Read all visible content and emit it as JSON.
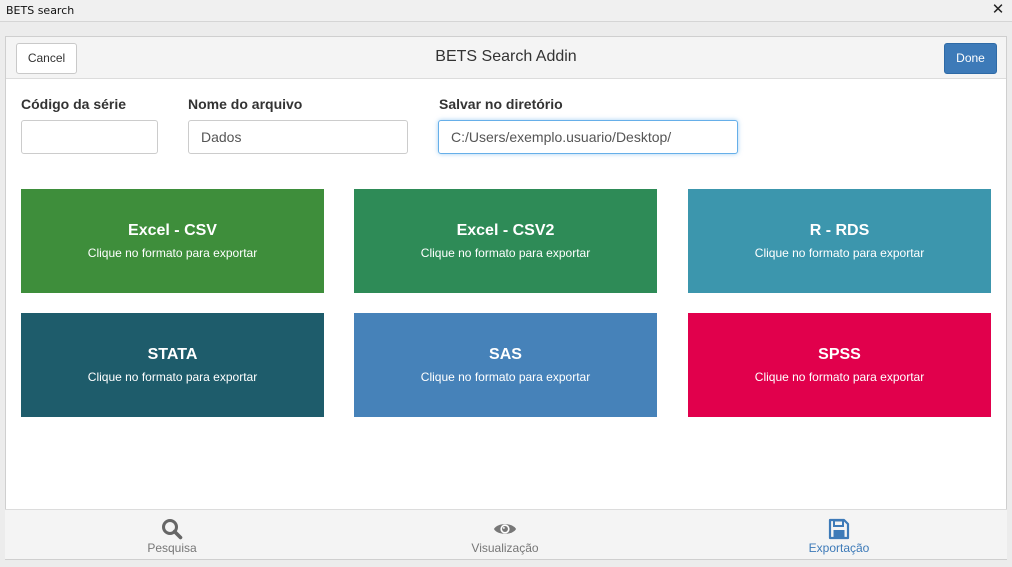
{
  "window": {
    "title": "BETS search",
    "close_glyph": "✕"
  },
  "header": {
    "title": "BETS Search Addin",
    "cancel_label": "Cancel",
    "done_label": "Done"
  },
  "form": {
    "codigo": {
      "label": "Código da série",
      "value": ""
    },
    "nome": {
      "label": "Nome do arquivo",
      "value": "Dados"
    },
    "diretorio": {
      "label": "Salvar no diretório",
      "value": "C:/Users/exemplo.usuario/Desktop/"
    }
  },
  "formats": [
    {
      "title": "Excel - CSV",
      "subtitle": "Clique no formato para exportar",
      "color": "#3e8e3b"
    },
    {
      "title": "Excel - CSV2",
      "subtitle": "Clique no formato para exportar",
      "color": "#2e8b57"
    },
    {
      "title": "R - RDS",
      "subtitle": "Clique no formato para exportar",
      "color": "#3c96ad"
    },
    {
      "title": "STATA",
      "subtitle": "Clique no formato para exportar",
      "color": "#1e5c6b"
    },
    {
      "title": "SAS",
      "subtitle": "Clique no formato para exportar",
      "color": "#4682b9"
    },
    {
      "title": "SPSS",
      "subtitle": "Clique no formato para exportar",
      "color": "#e1004c"
    }
  ],
  "tabs": [
    {
      "label": "Pesquisa",
      "icon": "search-icon",
      "active": false
    },
    {
      "label": "Visualização",
      "icon": "eye-icon",
      "active": false
    },
    {
      "label": "Exportação",
      "icon": "save-icon",
      "active": true
    }
  ],
  "colors": {
    "tab_active": "#3d7ab8",
    "tab_inactive": "#777777",
    "icon_inactive": "#666666"
  }
}
